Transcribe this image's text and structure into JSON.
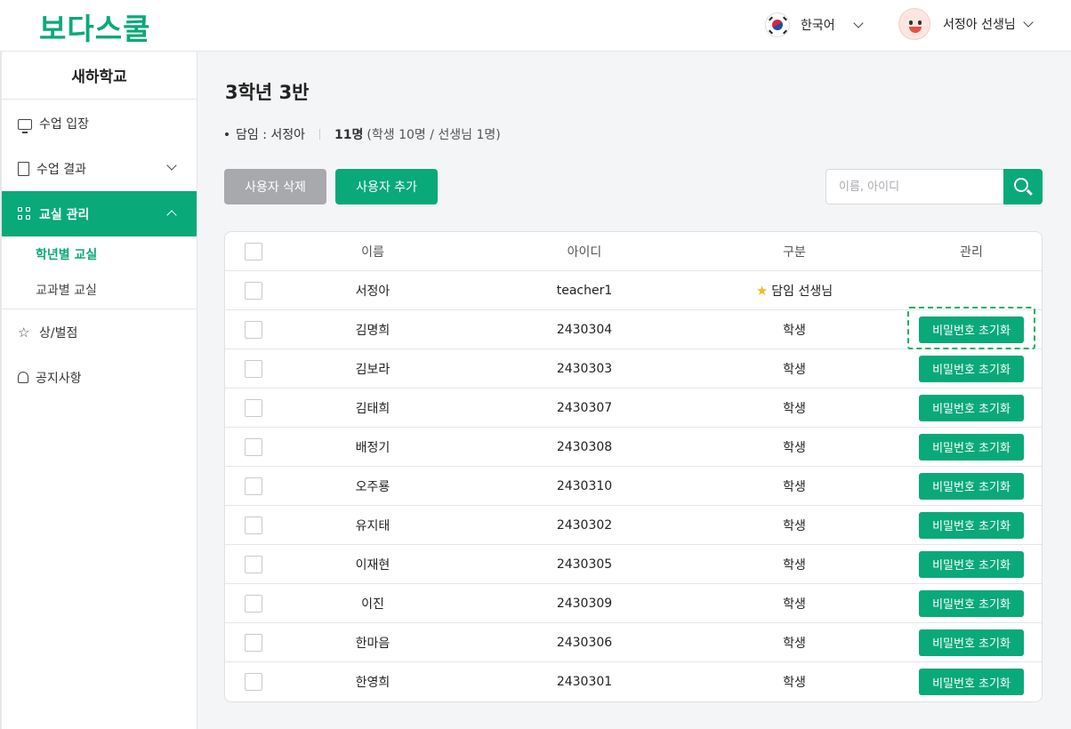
{
  "header": {
    "logo": "보다스쿨",
    "language": "한국어",
    "user_name": "서정아 선생님"
  },
  "sidebar": {
    "school": "새하학교",
    "items": [
      {
        "label": "수업 입장",
        "icon": "monitor-icon"
      },
      {
        "label": "수업 결과",
        "icon": "book-icon"
      },
      {
        "label": "교실 관리",
        "icon": "grid-icon"
      },
      {
        "label": "상/벌점",
        "icon": "star-icon"
      },
      {
        "label": "공지사항",
        "icon": "bell-icon"
      }
    ],
    "sub_items": [
      {
        "label": "학년별 교실"
      },
      {
        "label": "교과별 교실"
      }
    ]
  },
  "main": {
    "title": "3학년 3반",
    "homeroom": "담임 : 서정아",
    "count": "11명",
    "count_detail": "(학생 10명 / 선생님 1명)",
    "delete_button": "사용자 삭제",
    "add_button": "사용자 추가",
    "search_placeholder": "이름, 아이디"
  },
  "table": {
    "headers": {
      "name": "이름",
      "id": "아이디",
      "type": "구분",
      "manage": "관리"
    },
    "reset_label": "비밀번호 초기화",
    "rows": [
      {
        "name": "서정아",
        "id": "teacher1",
        "type": "담임 선생님",
        "teacher": true
      },
      {
        "name": "김명희",
        "id": "2430304",
        "type": "학생"
      },
      {
        "name": "김보라",
        "id": "2430303",
        "type": "학생"
      },
      {
        "name": "김태희",
        "id": "2430307",
        "type": "학생"
      },
      {
        "name": "배정기",
        "id": "2430308",
        "type": "학생"
      },
      {
        "name": "오주룡",
        "id": "2430310",
        "type": "학생"
      },
      {
        "name": "유지태",
        "id": "2430302",
        "type": "학생"
      },
      {
        "name": "이재현",
        "id": "2430305",
        "type": "학생"
      },
      {
        "name": "이진",
        "id": "2430309",
        "type": "학생"
      },
      {
        "name": "한마음",
        "id": "2430306",
        "type": "학생"
      },
      {
        "name": "한영희",
        "id": "2430301",
        "type": "학생"
      }
    ]
  },
  "colors": {
    "accent": "#0aa979",
    "disabled": "#a7a9ac",
    "highlight": "#18b05a"
  }
}
